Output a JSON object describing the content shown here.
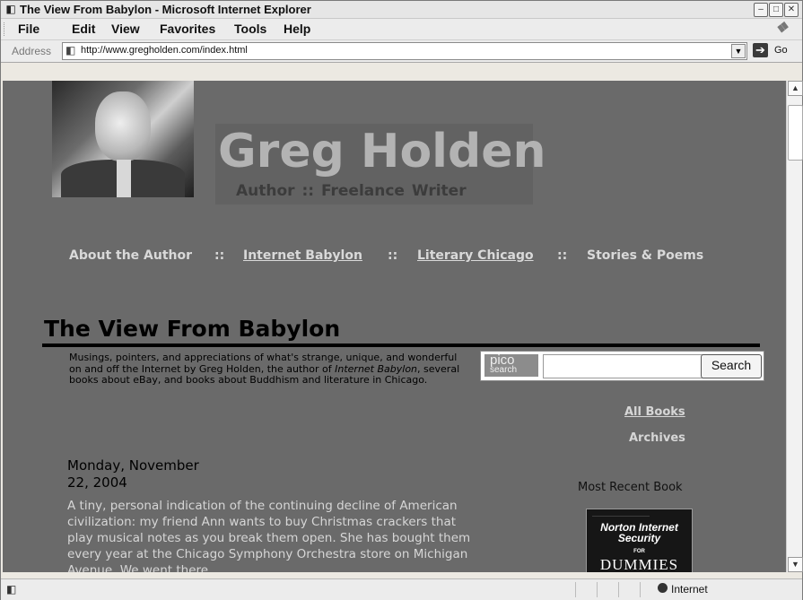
{
  "window": {
    "title": "The View From Babylon - Microsoft Internet Explorer",
    "icon": "ie-page-icon",
    "controls": [
      "minimize",
      "maximize",
      "close"
    ]
  },
  "menu": {
    "items": [
      "File",
      "Edit",
      "View",
      "Favorites",
      "Tools",
      "Help"
    ]
  },
  "address": {
    "label": "Address",
    "url": "http://www.gregholden.com/index.html",
    "go_label": "Go"
  },
  "page": {
    "site_name": "Greg Holden",
    "tagline": "Author  ::  Freelance Writer",
    "nav": {
      "about": "About the Author",
      "sep": "::",
      "babylon": "Internet Babylon",
      "chicago": "Literary Chicago",
      "stories": "Stories & Poems"
    },
    "blog_title": "The View From Babylon",
    "description": {
      "part1": "Musings, pointers, and appreciations of what's strange, unique, and wonderful on and off the Internet by Greg Holden, the author of ",
      "book": "Internet Babylon",
      "part2": ", several books about eBay, and books about Buddhism and literature in Chicago."
    },
    "search": {
      "logo_top": "pico",
      "logo_bottom": "search",
      "button": "Search",
      "value": ""
    },
    "sidebar": {
      "all_books": "All Books",
      "archives": "Archives",
      "recent_label": "Most Recent Book",
      "book": {
        "title_line1": "Norton Internet",
        "title_line2": "Security",
        "for": "FOR",
        "brand": "DUMMIES"
      }
    },
    "post": {
      "date_line1": "Monday, November",
      "date_line2": "22, 2004",
      "body": "A tiny, personal indication of the continuing decline of American civilization: my friend Ann wants to buy Christmas crackers that play musical notes as you break them open. She has bought them every year at the Chicago Symphony Orchestra store on Michigan Avenue. We went there"
    }
  },
  "status": {
    "zone": "Internet"
  },
  "colors": {
    "page_bg": "#6a6a6a",
    "title_text": "#000000",
    "nav_text": "#d9d9d9",
    "site_name": "#b3b3b3"
  }
}
